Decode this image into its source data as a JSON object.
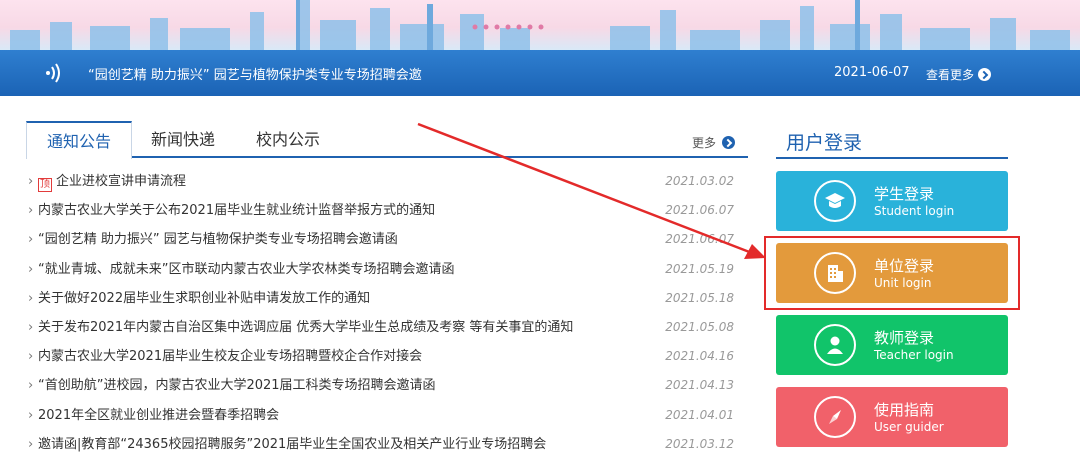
{
  "notice_bar": {
    "text": "“园创艺精 助力振兴” 园艺与植物保护类专业专场招聘会邀",
    "date": "2021-06-07",
    "more": "查看更多"
  },
  "tabs": [
    {
      "label": "通知公告",
      "active": true
    },
    {
      "label": "新闻快递",
      "active": false
    },
    {
      "label": "校内公示",
      "active": false
    }
  ],
  "more_label": "更多",
  "top_badge": "顶",
  "news": [
    {
      "title": "企业进校宣讲申请流程",
      "date": "2021.03.02",
      "pinned": true
    },
    {
      "title": "内蒙古农业大学关于公布2021届毕业生就业统计监督举报方式的通知",
      "date": "2021.06.07"
    },
    {
      "title": "“园创艺精 助力振兴” 园艺与植物保护类专业专场招聘会邀请函",
      "date": "2021.06.07"
    },
    {
      "title": "“就业青城、成就未来”区市联动内蒙古农业大学农林类专场招聘会邀请函",
      "date": "2021.05.19"
    },
    {
      "title": "关于做好2022届毕业生求职创业补贴申请发放工作的通知",
      "date": "2021.05.18"
    },
    {
      "title": "关于发布2021年内蒙古自治区集中选调应届 优秀大学毕业生总成绩及考察 等有关事宜的通知",
      "date": "2021.05.08"
    },
    {
      "title": "内蒙古农业大学2021届毕业生校友企业专场招聘暨校企合作对接会",
      "date": "2021.04.16"
    },
    {
      "title": "“首创助航”进校园，内蒙古农业大学2021届工科类专场招聘会邀请函",
      "date": "2021.04.13"
    },
    {
      "title": "2021年全区就业创业推进会暨春季招聘会",
      "date": "2021.04.01"
    },
    {
      "title": "邀请函|教育部“24365校园招聘服务”2021届毕业生全国农业及相关产业行业专场招聘会",
      "date": "2021.03.12"
    }
  ],
  "login": {
    "title": "用户登录",
    "buttons": [
      {
        "zh": "学生登录",
        "en": "Student login",
        "color": "#29b2da",
        "icon": "graduation-cap-icon"
      },
      {
        "zh": "单位登录",
        "en": "Unit login",
        "color": "#e39a3c",
        "icon": "building-icon"
      },
      {
        "zh": "教师登录",
        "en": "Teacher login",
        "color": "#11c46a",
        "icon": "person-icon"
      },
      {
        "zh": "使用指南",
        "en": "User guider",
        "color": "#f1616a",
        "icon": "compass-icon"
      }
    ]
  },
  "colors": {
    "primary_blue": "#1f62b0",
    "highlight_red": "#e32a2a"
  }
}
